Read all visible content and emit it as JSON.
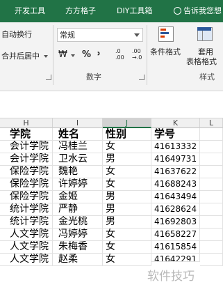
{
  "tabs": [
    "开发工具",
    "方方格子",
    "DIY工具箱"
  ],
  "tell_me": "告诉我您想",
  "ribbon": {
    "wrap_text": "自动换行",
    "merge_center": "合并后居中",
    "number_format_value": "常规",
    "currency_symbol": "₩",
    "percent_symbol": "%",
    "comma_symbol": "᠈",
    "inc_decimal": ".0\n.00",
    "dec_decimal": ".00\n→.0",
    "number_group_label": "数字",
    "cond_format_label": "条件格式",
    "table_format_label_1": "套用",
    "table_format_label_2": "表格格式",
    "styles_group_label": "样式"
  },
  "columns": [
    "H",
    "I",
    "J",
    "K",
    "L"
  ],
  "selected_column": "J",
  "rows": [
    [
      "学院",
      "姓名",
      "性别",
      "学号"
    ],
    [
      "会计学院",
      "冯桂兰",
      "女",
      "41613332"
    ],
    [
      "会计学院",
      "卫水云",
      "男",
      "41649731"
    ],
    [
      "保险学院",
      "魏艳",
      "女",
      "41637622"
    ],
    [
      "保险学院",
      "许婷婷",
      "女",
      "41688243"
    ],
    [
      "保险学院",
      "金姬",
      "男",
      "41643494"
    ],
    [
      "统计学院",
      "严静",
      "男",
      "41628624"
    ],
    [
      "统计学院",
      "金光桃",
      "男",
      "41692803"
    ],
    [
      "人文学院",
      "冯婷婷",
      "女",
      "41658227"
    ],
    [
      "人文学院",
      "朱梅香",
      "女",
      "41615854"
    ],
    [
      "人文学院",
      "赵柔",
      "女",
      "41642291"
    ]
  ],
  "watermark": "软件技巧"
}
